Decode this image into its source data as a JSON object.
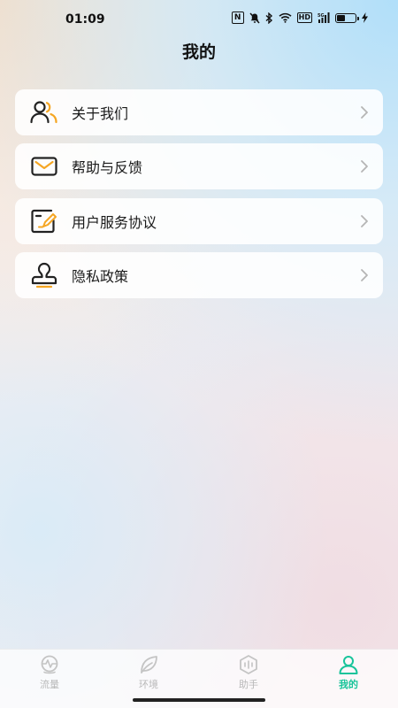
{
  "status_bar": {
    "time": "01:09",
    "icons": [
      "nfc-icon",
      "mute-icon",
      "bluetooth-icon",
      "wifi-icon",
      "hd-icon",
      "5g-signal-icon",
      "battery-icon",
      "charging-icon"
    ],
    "hd_label": "HD",
    "nfc_label": "N"
  },
  "header": {
    "title": "我的"
  },
  "menu": {
    "items": [
      {
        "label": "关于我们",
        "icon": "about-us-icon"
      },
      {
        "label": "帮助与反馈",
        "icon": "mail-icon"
      },
      {
        "label": "用户服务协议",
        "icon": "agreement-icon"
      },
      {
        "label": "隐私政策",
        "icon": "privacy-stamp-icon"
      }
    ]
  },
  "bottom_nav": {
    "tabs": [
      {
        "label": "流量",
        "icon": "traffic-icon",
        "active": false
      },
      {
        "label": "环境",
        "icon": "leaf-icon",
        "active": false
      },
      {
        "label": "助手",
        "icon": "assistant-icon",
        "active": false
      },
      {
        "label": "我的",
        "icon": "profile-icon",
        "active": true
      }
    ]
  },
  "colors": {
    "accent": "#18c49a",
    "icon_orange": "#f5a623",
    "icon_dark": "#222222",
    "tab_inactive": "#b8b8b8"
  }
}
